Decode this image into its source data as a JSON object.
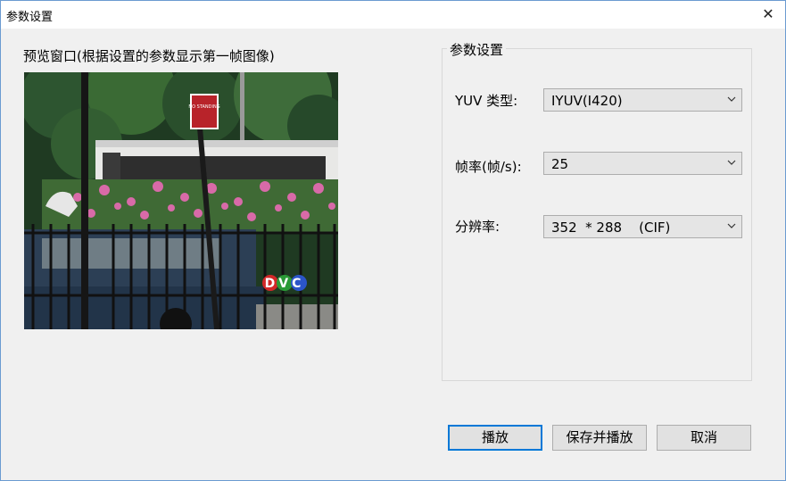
{
  "window": {
    "title": "参数设置",
    "close_glyph": "✕"
  },
  "preview": {
    "label": "预览窗口(根据设置的参数显示第一帧图像)",
    "logo_text": "DVC",
    "sign_text": "NO STANDING"
  },
  "params": {
    "group_title": "参数设置",
    "yuv_label": "YUV 类型:",
    "yuv_value": "IYUV(I420)",
    "fps_label": "帧率(帧/s):",
    "fps_value": "25",
    "res_label": "分辨率:",
    "res_value": "352  * 288    (CIF)"
  },
  "buttons": {
    "play": "播放",
    "save_play": "保存并播放",
    "cancel": "取消"
  }
}
